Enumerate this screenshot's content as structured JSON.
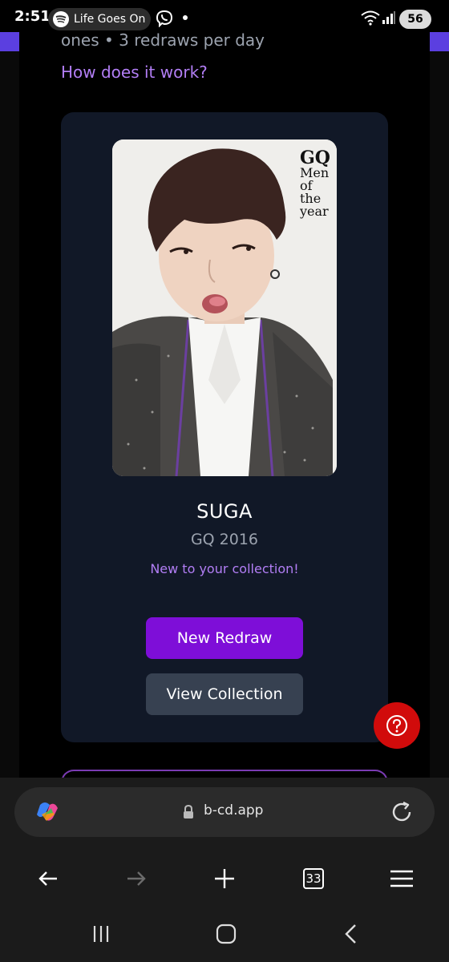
{
  "status_bar": {
    "time": "2:51",
    "media_title": "Life Goes On",
    "battery": "56"
  },
  "page": {
    "intro_text": "ones • 3 redraws per day",
    "how_link": "How does it work?"
  },
  "card": {
    "magazine_brand": "GQ",
    "magazine_tagline": "Men of the year",
    "name": "SUGA",
    "subtitle": "GQ 2016",
    "new_badge": "New to your collection!",
    "new_redraw_label": "New Redraw",
    "view_collection_label": "View Collection"
  },
  "help_button": {
    "icon": "question-icon"
  },
  "browser": {
    "url": "b-cd.app",
    "tabs_count": "33"
  },
  "colors": {
    "accent_purple": "#7e0ed8",
    "link_purple": "#b27ef5",
    "card_bg": "#111827",
    "help_red": "#d10b0b"
  }
}
